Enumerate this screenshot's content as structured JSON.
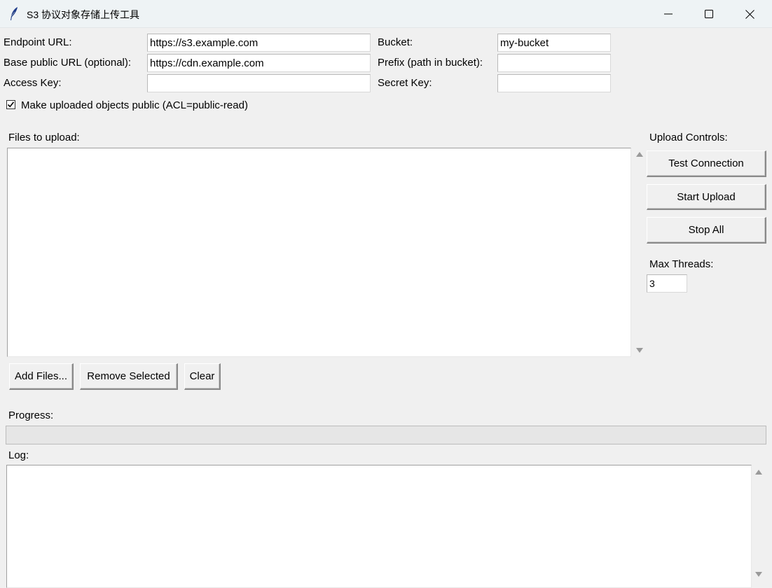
{
  "window": {
    "title": "S3 协议对象存储上传工具",
    "icon": "feather-icon"
  },
  "config": {
    "endpoint_label": "Endpoint URL:",
    "endpoint_value": "https://s3.example.com",
    "base_url_label": "Base public URL (optional):",
    "base_url_value": "https://cdn.example.com",
    "access_key_label": "Access Key:",
    "access_key_value": "",
    "bucket_label": "Bucket:",
    "bucket_value": "my-bucket",
    "prefix_label": "Prefix (path in bucket):",
    "prefix_value": "",
    "secret_key_label": "Secret Key:",
    "secret_key_value": ""
  },
  "public_checkbox": {
    "label": "Make uploaded objects public (ACL=public-read)",
    "checked": true
  },
  "files": {
    "label": "Files to upload:",
    "items": [],
    "add_label": "Add Files...",
    "remove_label": "Remove Selected",
    "clear_label": "Clear"
  },
  "controls": {
    "title": "Upload Controls:",
    "test_label": "Test Connection",
    "start_label": "Start Upload",
    "stop_label": "Stop All",
    "threads_label": "Max Threads:",
    "threads_value": "3"
  },
  "progress": {
    "label": "Progress:",
    "value": 0
  },
  "log": {
    "label": "Log:",
    "lines": []
  },
  "colors": {
    "progress_fill": "#06b025",
    "titlebar_bg": "#eef3f5"
  }
}
